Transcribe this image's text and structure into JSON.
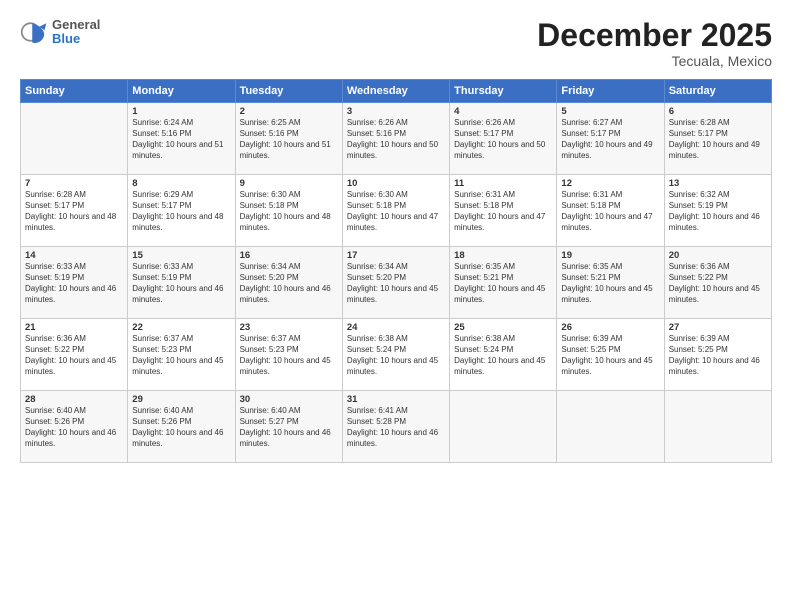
{
  "logo": {
    "general": "General",
    "blue": "Blue"
  },
  "header": {
    "month": "December 2025",
    "location": "Tecuala, Mexico"
  },
  "days_of_week": [
    "Sunday",
    "Monday",
    "Tuesday",
    "Wednesday",
    "Thursday",
    "Friday",
    "Saturday"
  ],
  "weeks": [
    [
      {
        "day": "",
        "sunrise": "",
        "sunset": "",
        "daylight": ""
      },
      {
        "day": "1",
        "sunrise": "Sunrise: 6:24 AM",
        "sunset": "Sunset: 5:16 PM",
        "daylight": "Daylight: 10 hours and 51 minutes."
      },
      {
        "day": "2",
        "sunrise": "Sunrise: 6:25 AM",
        "sunset": "Sunset: 5:16 PM",
        "daylight": "Daylight: 10 hours and 51 minutes."
      },
      {
        "day": "3",
        "sunrise": "Sunrise: 6:26 AM",
        "sunset": "Sunset: 5:16 PM",
        "daylight": "Daylight: 10 hours and 50 minutes."
      },
      {
        "day": "4",
        "sunrise": "Sunrise: 6:26 AM",
        "sunset": "Sunset: 5:17 PM",
        "daylight": "Daylight: 10 hours and 50 minutes."
      },
      {
        "day": "5",
        "sunrise": "Sunrise: 6:27 AM",
        "sunset": "Sunset: 5:17 PM",
        "daylight": "Daylight: 10 hours and 49 minutes."
      },
      {
        "day": "6",
        "sunrise": "Sunrise: 6:28 AM",
        "sunset": "Sunset: 5:17 PM",
        "daylight": "Daylight: 10 hours and 49 minutes."
      }
    ],
    [
      {
        "day": "7",
        "sunrise": "Sunrise: 6:28 AM",
        "sunset": "Sunset: 5:17 PM",
        "daylight": "Daylight: 10 hours and 48 minutes."
      },
      {
        "day": "8",
        "sunrise": "Sunrise: 6:29 AM",
        "sunset": "Sunset: 5:17 PM",
        "daylight": "Daylight: 10 hours and 48 minutes."
      },
      {
        "day": "9",
        "sunrise": "Sunrise: 6:30 AM",
        "sunset": "Sunset: 5:18 PM",
        "daylight": "Daylight: 10 hours and 48 minutes."
      },
      {
        "day": "10",
        "sunrise": "Sunrise: 6:30 AM",
        "sunset": "Sunset: 5:18 PM",
        "daylight": "Daylight: 10 hours and 47 minutes."
      },
      {
        "day": "11",
        "sunrise": "Sunrise: 6:31 AM",
        "sunset": "Sunset: 5:18 PM",
        "daylight": "Daylight: 10 hours and 47 minutes."
      },
      {
        "day": "12",
        "sunrise": "Sunrise: 6:31 AM",
        "sunset": "Sunset: 5:18 PM",
        "daylight": "Daylight: 10 hours and 47 minutes."
      },
      {
        "day": "13",
        "sunrise": "Sunrise: 6:32 AM",
        "sunset": "Sunset: 5:19 PM",
        "daylight": "Daylight: 10 hours and 46 minutes."
      }
    ],
    [
      {
        "day": "14",
        "sunrise": "Sunrise: 6:33 AM",
        "sunset": "Sunset: 5:19 PM",
        "daylight": "Daylight: 10 hours and 46 minutes."
      },
      {
        "day": "15",
        "sunrise": "Sunrise: 6:33 AM",
        "sunset": "Sunset: 5:19 PM",
        "daylight": "Daylight: 10 hours and 46 minutes."
      },
      {
        "day": "16",
        "sunrise": "Sunrise: 6:34 AM",
        "sunset": "Sunset: 5:20 PM",
        "daylight": "Daylight: 10 hours and 46 minutes."
      },
      {
        "day": "17",
        "sunrise": "Sunrise: 6:34 AM",
        "sunset": "Sunset: 5:20 PM",
        "daylight": "Daylight: 10 hours and 45 minutes."
      },
      {
        "day": "18",
        "sunrise": "Sunrise: 6:35 AM",
        "sunset": "Sunset: 5:21 PM",
        "daylight": "Daylight: 10 hours and 45 minutes."
      },
      {
        "day": "19",
        "sunrise": "Sunrise: 6:35 AM",
        "sunset": "Sunset: 5:21 PM",
        "daylight": "Daylight: 10 hours and 45 minutes."
      },
      {
        "day": "20",
        "sunrise": "Sunrise: 6:36 AM",
        "sunset": "Sunset: 5:22 PM",
        "daylight": "Daylight: 10 hours and 45 minutes."
      }
    ],
    [
      {
        "day": "21",
        "sunrise": "Sunrise: 6:36 AM",
        "sunset": "Sunset: 5:22 PM",
        "daylight": "Daylight: 10 hours and 45 minutes."
      },
      {
        "day": "22",
        "sunrise": "Sunrise: 6:37 AM",
        "sunset": "Sunset: 5:23 PM",
        "daylight": "Daylight: 10 hours and 45 minutes."
      },
      {
        "day": "23",
        "sunrise": "Sunrise: 6:37 AM",
        "sunset": "Sunset: 5:23 PM",
        "daylight": "Daylight: 10 hours and 45 minutes."
      },
      {
        "day": "24",
        "sunrise": "Sunrise: 6:38 AM",
        "sunset": "Sunset: 5:24 PM",
        "daylight": "Daylight: 10 hours and 45 minutes."
      },
      {
        "day": "25",
        "sunrise": "Sunrise: 6:38 AM",
        "sunset": "Sunset: 5:24 PM",
        "daylight": "Daylight: 10 hours and 45 minutes."
      },
      {
        "day": "26",
        "sunrise": "Sunrise: 6:39 AM",
        "sunset": "Sunset: 5:25 PM",
        "daylight": "Daylight: 10 hours and 45 minutes."
      },
      {
        "day": "27",
        "sunrise": "Sunrise: 6:39 AM",
        "sunset": "Sunset: 5:25 PM",
        "daylight": "Daylight: 10 hours and 46 minutes."
      }
    ],
    [
      {
        "day": "28",
        "sunrise": "Sunrise: 6:40 AM",
        "sunset": "Sunset: 5:26 PM",
        "daylight": "Daylight: 10 hours and 46 minutes."
      },
      {
        "day": "29",
        "sunrise": "Sunrise: 6:40 AM",
        "sunset": "Sunset: 5:26 PM",
        "daylight": "Daylight: 10 hours and 46 minutes."
      },
      {
        "day": "30",
        "sunrise": "Sunrise: 6:40 AM",
        "sunset": "Sunset: 5:27 PM",
        "daylight": "Daylight: 10 hours and 46 minutes."
      },
      {
        "day": "31",
        "sunrise": "Sunrise: 6:41 AM",
        "sunset": "Sunset: 5:28 PM",
        "daylight": "Daylight: 10 hours and 46 minutes."
      },
      {
        "day": "",
        "sunrise": "",
        "sunset": "",
        "daylight": ""
      },
      {
        "day": "",
        "sunrise": "",
        "sunset": "",
        "daylight": ""
      },
      {
        "day": "",
        "sunrise": "",
        "sunset": "",
        "daylight": ""
      }
    ]
  ]
}
